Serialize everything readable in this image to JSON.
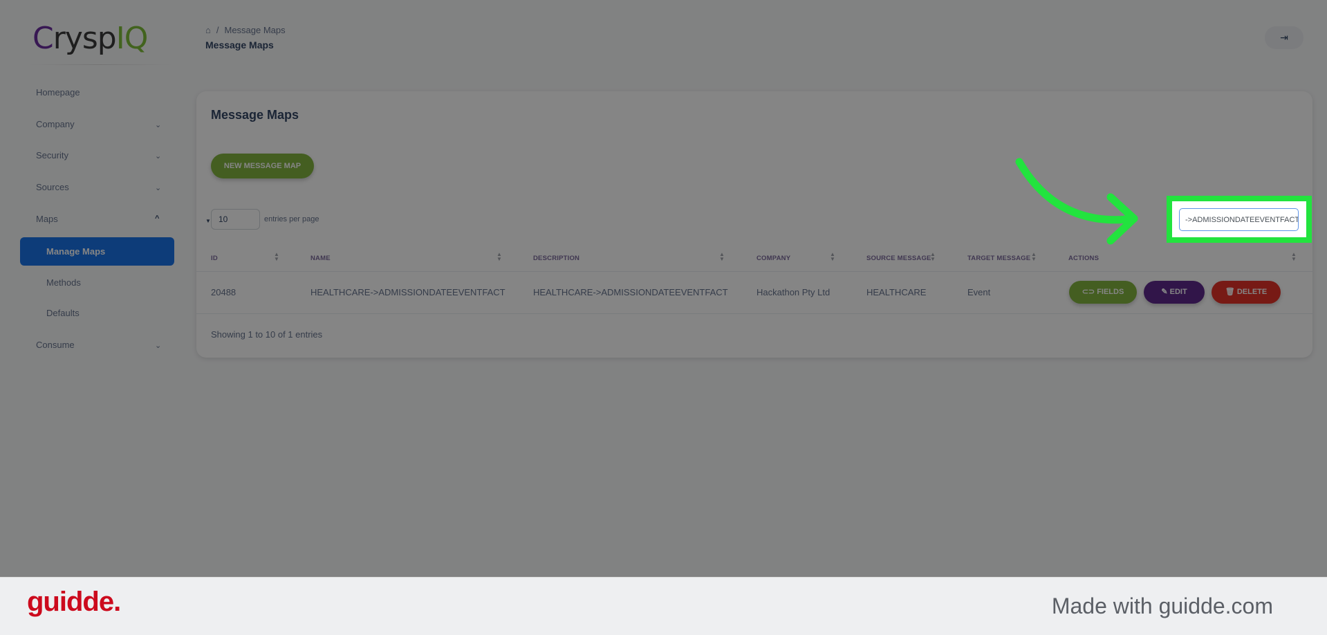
{
  "brand": {
    "logo_text_main": "Crysp",
    "logo_text_accent": "IQ"
  },
  "header": {
    "breadcrumb": [
      "Message Maps"
    ],
    "title": "Message Maps",
    "logout_icon": "logout-icon"
  },
  "sidebar": {
    "items": [
      {
        "label": "Homepage"
      },
      {
        "label": "Company",
        "chevron": "down"
      },
      {
        "label": "Security",
        "chevron": "down"
      },
      {
        "label": "Sources",
        "chevron": "down"
      },
      {
        "label": "Maps",
        "chevron": "up"
      },
      {
        "label": "Manage Maps",
        "active": true
      },
      {
        "label": "Methods"
      },
      {
        "label": "Defaults"
      },
      {
        "label": "Consume",
        "chevron": "down"
      }
    ]
  },
  "card": {
    "title": "Message Maps",
    "new_button": "NEW MESSAGE MAP",
    "entries_value": "10",
    "entries_label": "entries per page",
    "search_value": "->ADMISSIONDATEEVENTFACT",
    "columns": [
      "ID",
      "NAME",
      "DESCRIPTION",
      "COMPANY",
      "SOURCE MESSAGE",
      "TARGET MESSAGE",
      "ACTIONS"
    ],
    "rows": [
      {
        "id": "20488",
        "name": "HEALTHCARE->ADMISSIONDATEEVENTFACT",
        "description": "HEALTHCARE->ADMISSIONDATEEVENTFACT",
        "company": "Hackathon Pty Ltd",
        "source": "HEALTHCARE",
        "target": "Event"
      }
    ],
    "actions": {
      "fields": "FIELDS",
      "edit": "EDIT",
      "delete": "DELETE"
    },
    "showing": "Showing 1 to 10 of 1 entries"
  },
  "colors": {
    "fields": "#82b440",
    "edit": "#5e2a8c",
    "delete": "#e5332a",
    "active": "#1a73e8",
    "highlight": "#22e33e"
  },
  "footer": {
    "brand": "guidde.",
    "made_with": "Made with guidde.com"
  }
}
